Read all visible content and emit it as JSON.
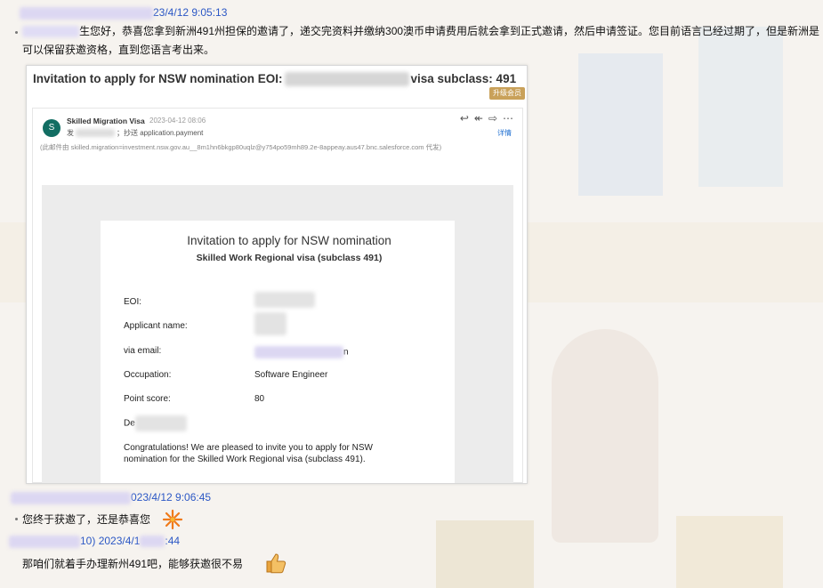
{
  "messages": [
    {
      "time": "23/4/12 9:05:13",
      "text": "生您好，恭喜您拿到新洲491州担保的邀请了，递交完资料并缴纳300澳币申请费用后就会拿到正式邀请，然后申请签证。您目前语言已经过期了，但是新洲是可以保留获邀资格，直到您语言考出来。"
    },
    {
      "time": "023/4/12 9:06:45",
      "text": "您终于获邀了，还是恭喜您"
    },
    {
      "time_prefix": "10)",
      "time": "2023/4/1",
      "time_suffix": ":44",
      "text": "那咱们就着手办理新州491吧，能够获邀很不易"
    }
  ],
  "card": {
    "title_left": "Invitation to apply for NSW nomination  EOI:",
    "title_right": "visa subclass: 491",
    "badge": "升级会员"
  },
  "email": {
    "avatar_letter": "S",
    "sender": "Skilled Migration Visa",
    "date": "2023-04-12 08:06",
    "to_prefix": "发",
    "to_suffix": "；抄送 application.payment",
    "via": "(此邮件由 skilled.migration=investment.nsw.gov.au__8m1hn6bkgp80uqlz@y754po59mh89.2e-8appeay.aus47.bnc.salesforce.com 代发)",
    "detail_link": "详情",
    "actions": [
      "reply-icon",
      "reply-all-icon",
      "forward-icon",
      "more-icon"
    ]
  },
  "doc": {
    "title": "Invitation to apply for NSW nomination",
    "subtitle": "Skilled Work Regional visa (subclass 491)",
    "rows": [
      {
        "label": "EOI:",
        "value": ""
      },
      {
        "label": "Applicant name:",
        "value": ""
      },
      {
        "label": "via email:",
        "value": "n"
      },
      {
        "label": "Occupation:",
        "value": "Software Engineer"
      },
      {
        "label": "Point score:",
        "value": "80"
      },
      {
        "label": "De",
        "value": ""
      }
    ],
    "congrats": "Congratulations! We are pleased to invite you to apply for NSW nomination for the Skilled Work Regional visa (subclass 491)."
  }
}
